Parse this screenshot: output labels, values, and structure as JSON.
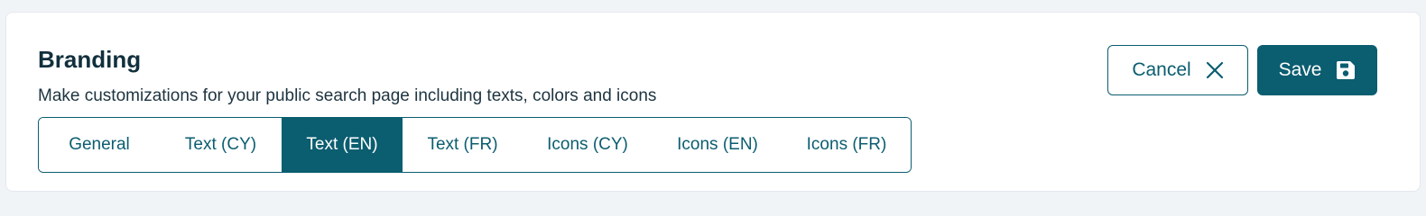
{
  "header": {
    "title": "Branding",
    "subtitle": "Make customizations for your public search page including texts, colors and icons"
  },
  "actions": {
    "cancel_label": "Cancel",
    "cancel_icon": "close-icon",
    "save_label": "Save",
    "save_icon": "floppy-disk-icon"
  },
  "tabs": [
    {
      "label": "General",
      "active": false
    },
    {
      "label": "Text (CY)",
      "active": false
    },
    {
      "label": "Text (EN)",
      "active": true
    },
    {
      "label": "Text (FR)",
      "active": false
    },
    {
      "label": "Icons (CY)",
      "active": false
    },
    {
      "label": "Icons (EN)",
      "active": false
    },
    {
      "label": "Icons (FR)",
      "active": false
    }
  ],
  "colors": {
    "primary": "#0b5d70",
    "page_background": "#f1f4f7",
    "heading_text": "#12303d"
  }
}
